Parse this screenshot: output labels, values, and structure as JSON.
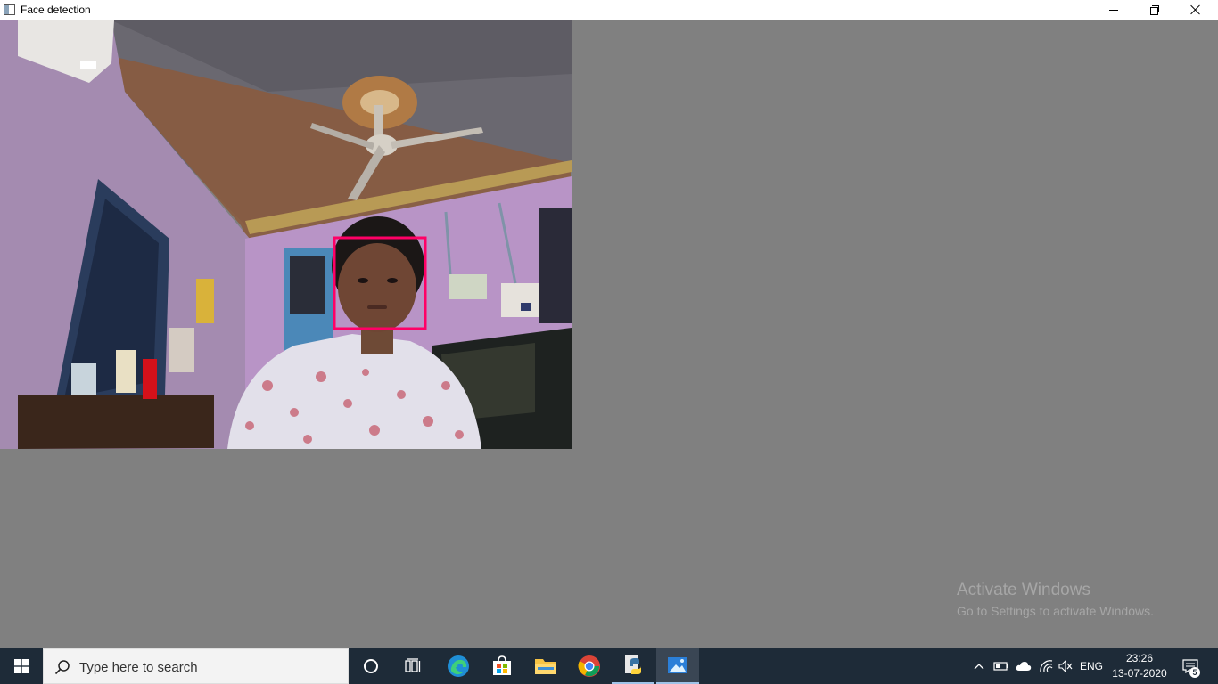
{
  "window": {
    "title": "Face detection",
    "controls": {
      "minimize": "minimize",
      "maximize": "restore",
      "close": "close"
    }
  },
  "camera_feed": {
    "detection_box_color": "#ff0066",
    "faces_detected": 1
  },
  "watermark": {
    "title": "Activate Windows",
    "subtitle": "Go to Settings to activate Windows."
  },
  "taskbar": {
    "search_placeholder": "Type here to search",
    "pinned": [
      {
        "name": "cortana-icon"
      },
      {
        "name": "task-view-icon"
      },
      {
        "name": "edge-icon"
      },
      {
        "name": "store-icon"
      },
      {
        "name": "file-explorer-icon"
      },
      {
        "name": "chrome-icon"
      },
      {
        "name": "python-icon",
        "running": true
      },
      {
        "name": "photos-icon",
        "active": true
      }
    ],
    "tray": {
      "language": "ENG",
      "time": "23:26",
      "date": "13-07-2020",
      "notification_count": "5"
    }
  },
  "colors": {
    "taskbar_bg": "#1e2b38",
    "client_bg": "#808080",
    "detection_box": "#ff0066"
  }
}
